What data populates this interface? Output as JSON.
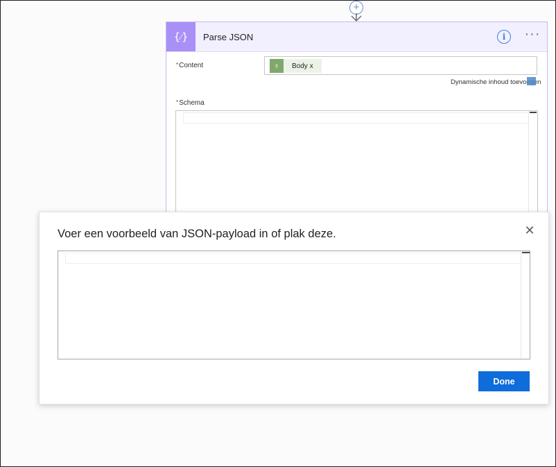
{
  "connector": {
    "add_symbol": "+",
    "add_icon": "plus-circle-icon",
    "arrow_icon": "arrow-down-icon"
  },
  "card": {
    "icon_glyph": "{⁄}",
    "icon_name": "parse-json-icon",
    "title": "Parse JSON",
    "info_glyph": "i",
    "more_glyph": "···",
    "content": {
      "required_mark": "*",
      "label": "Content",
      "token_label": "Body",
      "token_remove": "x",
      "token_icon": "bulb-icon",
      "token_glyph": "♁"
    },
    "dynamic_content_link": "Dynamische inhoud toevoegen",
    "schema": {
      "required_mark": "*",
      "label": "Schema"
    }
  },
  "dialog": {
    "title": "Voer een voorbeeld van JSON-payload in of plak deze.",
    "close_glyph": "✕",
    "done_label": "Done"
  },
  "colors": {
    "accent": "#a990f7",
    "primary_button": "#0f6cdb",
    "token_icon_bg": "#7fa86a"
  }
}
